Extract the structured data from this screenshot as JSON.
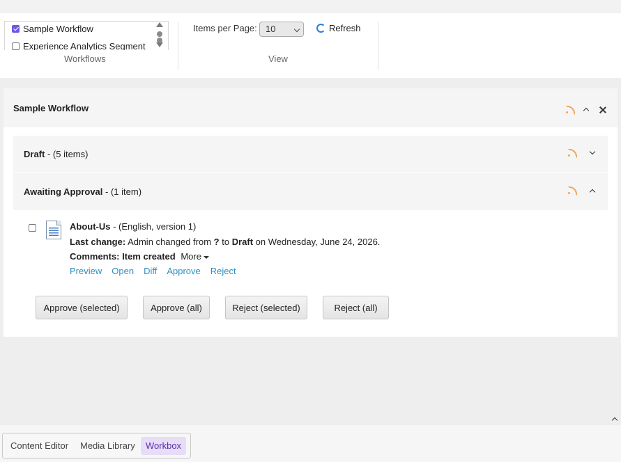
{
  "ribbon": {
    "workflows": {
      "items": [
        {
          "label": "Sample Workflow",
          "checked": true
        },
        {
          "label": "Experience Analytics Segment",
          "checked": false
        }
      ],
      "group_label": "Workflows"
    },
    "view": {
      "items_per_page_label": "Items per Page:",
      "items_per_page_value": "10",
      "refresh_label": "Refresh",
      "group_label": "View"
    }
  },
  "panel": {
    "title": "Sample Workflow",
    "states": [
      {
        "name": "Draft",
        "count_text": " - (5 items)",
        "expanded": false
      },
      {
        "name": "Awaiting Approval",
        "count_text": " - (1 item)",
        "expanded": true
      }
    ],
    "item": {
      "name": "About-Us",
      "meta": " - (English, version 1)",
      "last_change_label": "Last change:",
      "last_change_user": " Admin changed from ",
      "from_state": "?",
      "to_word": " to ",
      "to_state": "Draft",
      "date_text": " on Wednesday, June 24, 2026.",
      "comments_label": "Comments:",
      "comments_text": " Item created",
      "more_label": "More",
      "actions": [
        "Preview",
        "Open",
        "Diff",
        "Approve",
        "Reject"
      ]
    },
    "buttons": [
      "Approve (selected)",
      "Approve (all)",
      "Reject (selected)",
      "Reject (all)"
    ]
  },
  "taskbar": {
    "items": [
      "Content Editor",
      "Media Library",
      "Workbox"
    ],
    "active": "Workbox"
  },
  "colors": {
    "link": "#2e8fc4",
    "rss": "#f0a45c",
    "active_tab_bg": "#e7ddf6",
    "active_tab_text": "#5a2fb0"
  }
}
